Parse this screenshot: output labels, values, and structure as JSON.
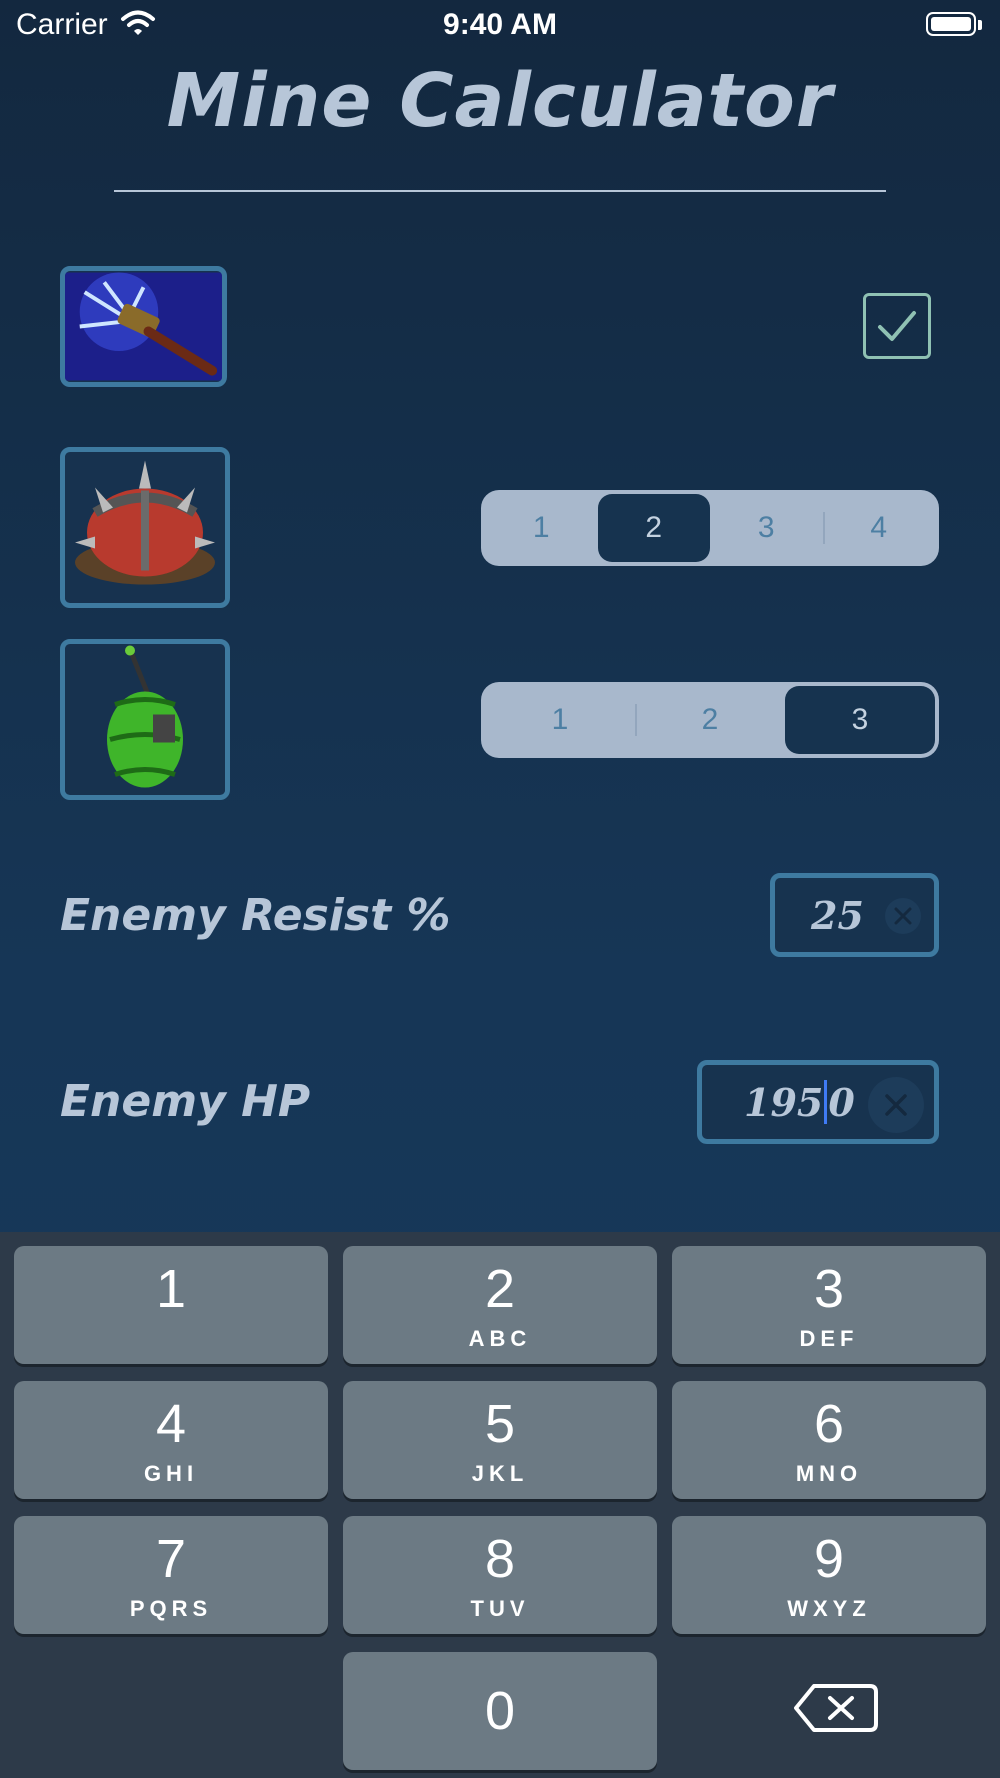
{
  "status_bar": {
    "carrier": "Carrier",
    "time": "9:40 AM"
  },
  "title": "Mine Calculator",
  "options": {
    "checkbox_checked": true,
    "segment_a": {
      "items": [
        "1",
        "2",
        "3",
        "4"
      ],
      "selected": "2"
    },
    "segment_b": {
      "items": [
        "1",
        "2",
        "3"
      ],
      "selected": "3"
    }
  },
  "resist": {
    "label": "Enemy Resist %",
    "value": "25"
  },
  "hp": {
    "label": "Enemy HP",
    "value_before_cursor": "195",
    "value_after_cursor": "0"
  },
  "keypad": {
    "keys": [
      {
        "num": "1",
        "letters": ""
      },
      {
        "num": "2",
        "letters": "ABC"
      },
      {
        "num": "3",
        "letters": "DEF"
      },
      {
        "num": "4",
        "letters": "GHI"
      },
      {
        "num": "5",
        "letters": "JKL"
      },
      {
        "num": "6",
        "letters": "MNO"
      },
      {
        "num": "7",
        "letters": "PQRS"
      },
      {
        "num": "8",
        "letters": "TUV"
      },
      {
        "num": "9",
        "letters": "WXYZ"
      },
      {
        "num": "0",
        "letters": ""
      }
    ]
  },
  "colors": {
    "background": "#163656",
    "accent_border": "#3e7aa0",
    "checkbox_border": "#8fc1b3",
    "caret": "#3f7bf5",
    "keyboard": "#2d3a49",
    "key": "#6c7a84"
  }
}
